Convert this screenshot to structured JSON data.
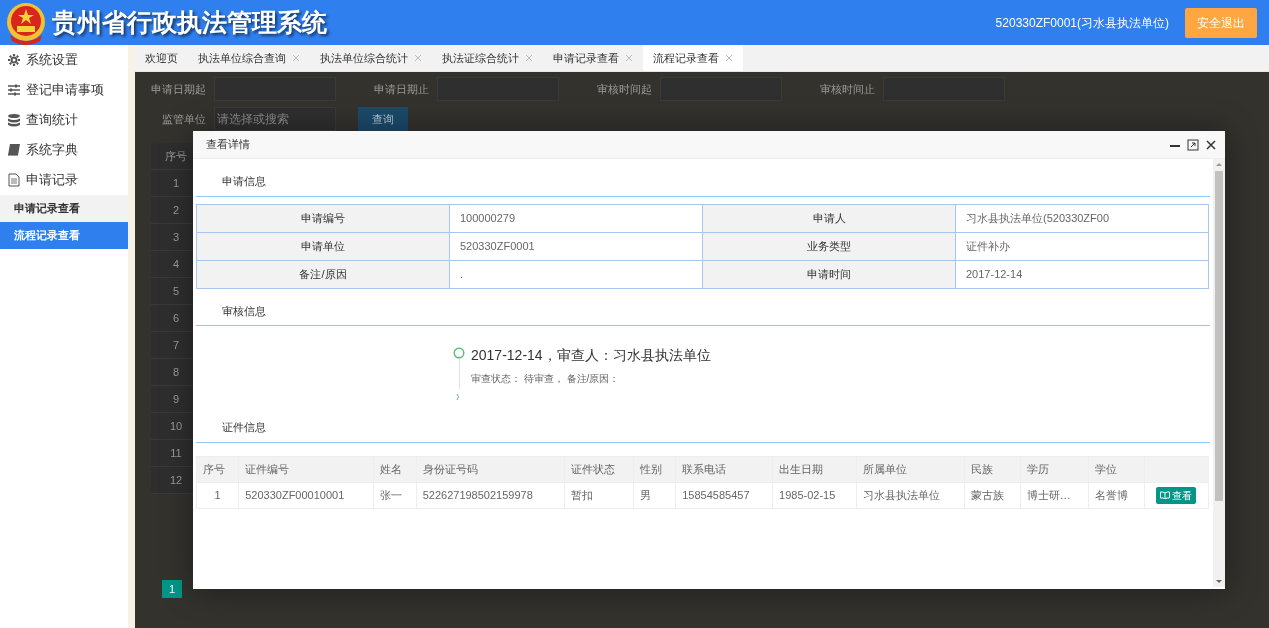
{
  "header": {
    "title": "贵州省行政执法管理系统",
    "user": "520330ZF0001(习水县执法单位)",
    "logout": "安全退出"
  },
  "sidebar": {
    "items": [
      {
        "label": "系统设置"
      },
      {
        "label": "登记申请事项"
      },
      {
        "label": "查询统计"
      },
      {
        "label": "系统字典"
      },
      {
        "label": "申请记录",
        "children": [
          {
            "label": "申请记录查看",
            "selected": false
          },
          {
            "label": "流程记录查看",
            "selected": true
          }
        ]
      }
    ]
  },
  "tabs": [
    {
      "label": "欢迎页",
      "closable": false,
      "selected": false
    },
    {
      "label": "执法单位综合查询",
      "closable": true,
      "selected": false
    },
    {
      "label": "执法单位综合统计",
      "closable": true,
      "selected": false
    },
    {
      "label": "执法证综合统计",
      "closable": true,
      "selected": false
    },
    {
      "label": "申请记录查看",
      "closable": true,
      "selected": false
    },
    {
      "label": "流程记录查看",
      "closable": true,
      "selected": true
    }
  ],
  "search_form": {
    "fields": [
      {
        "label": "申请日期起"
      },
      {
        "label": "申请日期止"
      },
      {
        "label": "审核时间起"
      },
      {
        "label": "审核时间止"
      }
    ],
    "unit": {
      "label": "监管单位",
      "placeholder": "请选择或搜索"
    },
    "button": "查询"
  },
  "list_table": {
    "header": "序号",
    "rows": [
      "1",
      "2",
      "3",
      "4",
      "5",
      "6",
      "7",
      "8",
      "9",
      "10",
      "11",
      "12"
    ]
  },
  "pagination": {
    "current": "1"
  },
  "modal": {
    "title": "查看详情",
    "apply_section": {
      "title": "申请信息",
      "rows": [
        {
          "label_1": "申请编号",
          "value_1": "100000279",
          "label_2": "申请人",
          "value_2": "习水县执法单位(520330ZF00"
        },
        {
          "label_1": "申请单位",
          "value_1": "520330ZF0001",
          "label_2": "业务类型",
          "value_2": "证件补办"
        },
        {
          "label_1": "备注/原因",
          "value_1": ".",
          "label_2": "申请时间",
          "value_2": "2017-12-14"
        }
      ]
    },
    "review_section": {
      "title": "审核信息",
      "entries": [
        {
          "title": "2017-12-14，审查人：习水县执法单位",
          "detail": "审查状态： 待审查， 备注/原因："
        }
      ]
    },
    "cert_section": {
      "title": "证件信息",
      "columns": [
        "序号",
        "证件编号",
        "姓名",
        "身份证号码",
        "证件状态",
        "性别",
        "联系电话",
        "出生日期",
        "所属单位",
        "民族",
        "学历",
        "学位"
      ],
      "rows": [
        {
          "cells": [
            "1",
            "520330ZF00010001",
            "张一",
            "522627198502159978",
            "暂扣",
            "男",
            "15854585457",
            "1985-02-15",
            "习水县执法单位",
            "蒙古族",
            "博士研…",
            "名誉博"
          ],
          "action": "查看"
        }
      ]
    }
  }
}
